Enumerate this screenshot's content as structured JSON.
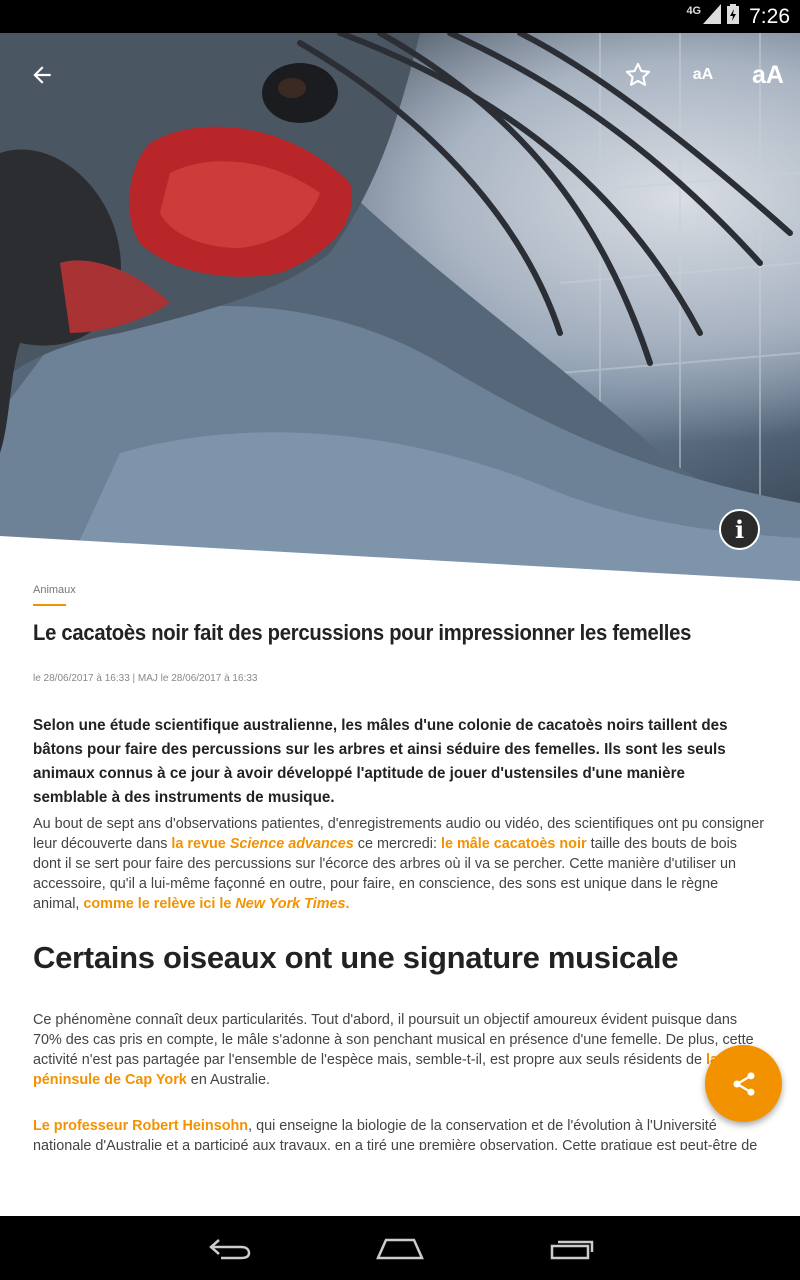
{
  "status_bar": {
    "network": "4G",
    "time": "7:26",
    "icons": [
      "signal-icon",
      "battery-icon"
    ]
  },
  "toolbar": {
    "back_icon": "arrow-left-icon",
    "favorite_icon": "star-outline-icon",
    "font_small_label": "aA",
    "font_large_label": "aA",
    "info_label": "i"
  },
  "article": {
    "category": "Animaux",
    "title": "Le cacatoès noir fait des percussions pour impressionner les femelles",
    "dates": "le 28/06/2017 à 16:33 | MAJ le 28/06/2017 à 16:33",
    "lead": "Selon une étude scientifique australienne, les mâles d'une colonie de cacatoès noirs taillent des bâtons pour faire des percussions sur les arbres et ainsi séduire des femelles. Ils sont les seuls animaux connus à ce jour à avoir développé l'aptitude de jouer d'ustensiles d'une manière semblable à des instruments de musique.",
    "p1": {
      "t1": "Au bout de sept ans d'observations patientes, d'enregistrements audio ou vidéo, des scientifiques ont pu consigner leur découverte dans ",
      "link1a": "la revue ",
      "link1b": "Science advances",
      "t2": " ce mercredi: ",
      "link2": "le mâle cacatoès noir",
      "t3": " taille des bouts de bois dont il se sert pour faire des percussions sur l'écorce des arbres où il va se percher. Cette manière d'utiliser un accessoire, qu'il a lui-même façonné en outre, pour faire, en conscience, des sons est unique dans le règne animal, ",
      "link3a": "comme le relève ici le ",
      "link3b": "New York Times",
      "t4": "."
    },
    "subheading": "Certains oiseaux ont une signature musicale",
    "p2": {
      "t1": "Ce phénomène connaît deux particularités. Tout d'abord, il poursuit un objectif amoureux évident puisque dans 70% des cas pris en compte, le mâle s'adonne à son penchant musical en présence d'une femelle. De plus, cette activité n'est pas partagée par l'ensemble de l'espèce mais, semble-t-il, est propre aux seuls résidents de ",
      "link1": "la péninsule de Cap York",
      "t2": " en Australie."
    },
    "p3": {
      "link1": "Le professeur Robert Heinsohn",
      "t1": ", qui enseigne la biologie de la conservation et de l'évolution à l'Université nationale d'Australie et a participé aux travaux, en a tiré une première observation. Cette pratique est peut-être de nature"
    }
  },
  "share_icon": "share-icon",
  "nav_bar": {
    "back_icon": "nav-back-icon",
    "home_icon": "nav-home-icon",
    "recents_icon": "nav-recents-icon"
  },
  "colors": {
    "accent": "#f39200",
    "text": "#222222",
    "status_bar": "#000000"
  }
}
